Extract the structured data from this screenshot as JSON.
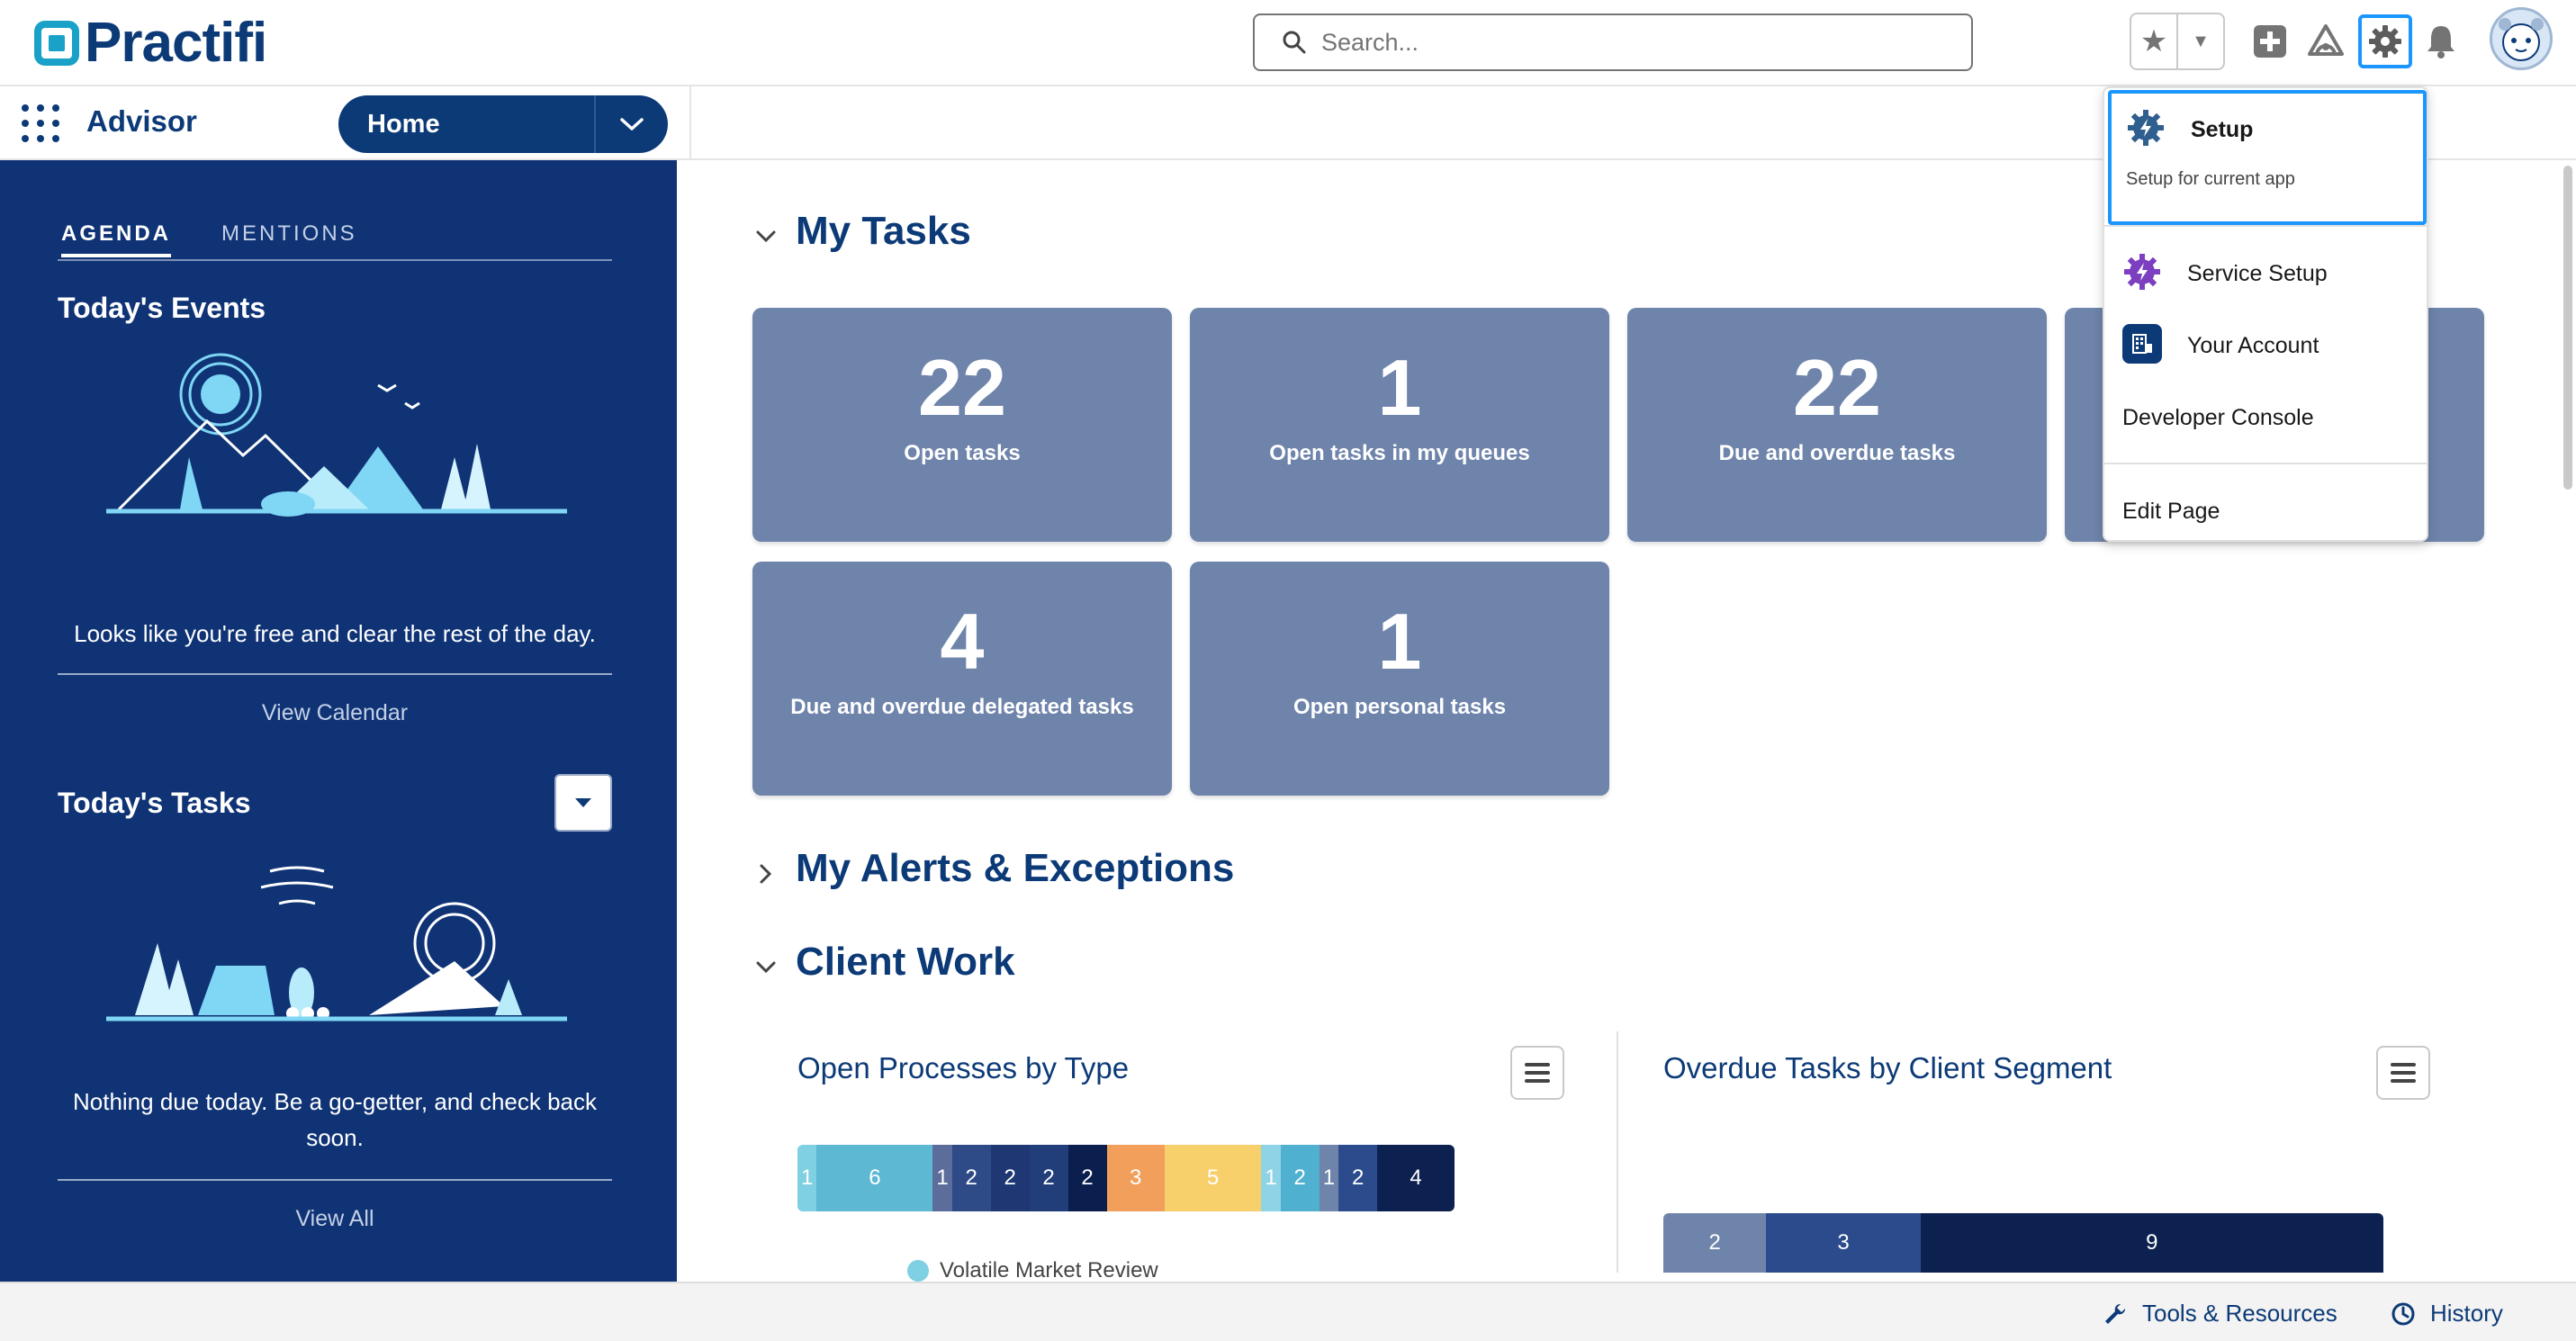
{
  "header": {
    "logo_text": "Practifi",
    "search_placeholder": "Search...",
    "icons": [
      "star-icon",
      "chevron-down-icon",
      "add-icon",
      "trailhead-icon",
      "gear-icon",
      "bell-icon",
      "avatar"
    ]
  },
  "nav": {
    "app_name": "Advisor",
    "current_tab": "Home"
  },
  "sidebar": {
    "tabs": [
      "AGENDA",
      "MENTIONS"
    ],
    "events_heading": "Today's Events",
    "events_empty": "Looks like you're free and clear the rest of the day.",
    "view_calendar": "View Calendar",
    "tasks_heading": "Today's Tasks",
    "tasks_empty": "Nothing due today. Be a go-getter, and check back soon.",
    "view_all": "View All"
  },
  "main": {
    "my_tasks_title": "My Tasks",
    "tiles": [
      {
        "value": "22",
        "label": "Open tasks"
      },
      {
        "value": "1",
        "label": "Open tasks in my queues"
      },
      {
        "value": "22",
        "label": "Due and overdue tasks"
      },
      {
        "value": "4",
        "label": "Due and overdue delegated tasks"
      },
      {
        "value": "1",
        "label": "Open personal tasks"
      }
    ],
    "alerts_title": "My Alerts & Exceptions",
    "client_work_title": "Client Work",
    "card1_title": "Open Processes by Type",
    "card2_title": "Overdue Tasks by Client Segment",
    "legend_partial": "Volatile Market Review"
  },
  "chart_data": [
    {
      "type": "bar",
      "orientation": "horizontal-stacked",
      "title": "Open Processes by Type",
      "values": [
        1,
        6,
        1,
        2,
        2,
        2,
        2,
        3,
        5,
        1,
        2,
        1,
        2,
        4
      ],
      "colors": [
        "#7fd0e2",
        "#5cb8d3",
        "#5c6d9c",
        "#2e4a87",
        "#1f3873",
        "#213d7a",
        "#0b1f4f",
        "#f29f5b",
        "#f7cf6b",
        "#8ed3e6",
        "#4fb0cf",
        "#6f84ab",
        "#2b4b8c",
        "#0c2150"
      ]
    },
    {
      "type": "bar",
      "orientation": "horizontal-stacked",
      "title": "Overdue Tasks by Client Segment",
      "values": [
        2,
        3,
        9
      ],
      "colors": [
        "#6f84ab",
        "#2b4b8c",
        "#0c2150"
      ]
    }
  ],
  "setup_menu": {
    "setup_label": "Setup",
    "setup_sub": "Setup for current app",
    "service_setup": "Service Setup",
    "your_account": "Your Account",
    "developer_console": "Developer Console",
    "edit_page": "Edit Page"
  },
  "footer": {
    "tools": "Tools & Resources",
    "history": "History"
  }
}
